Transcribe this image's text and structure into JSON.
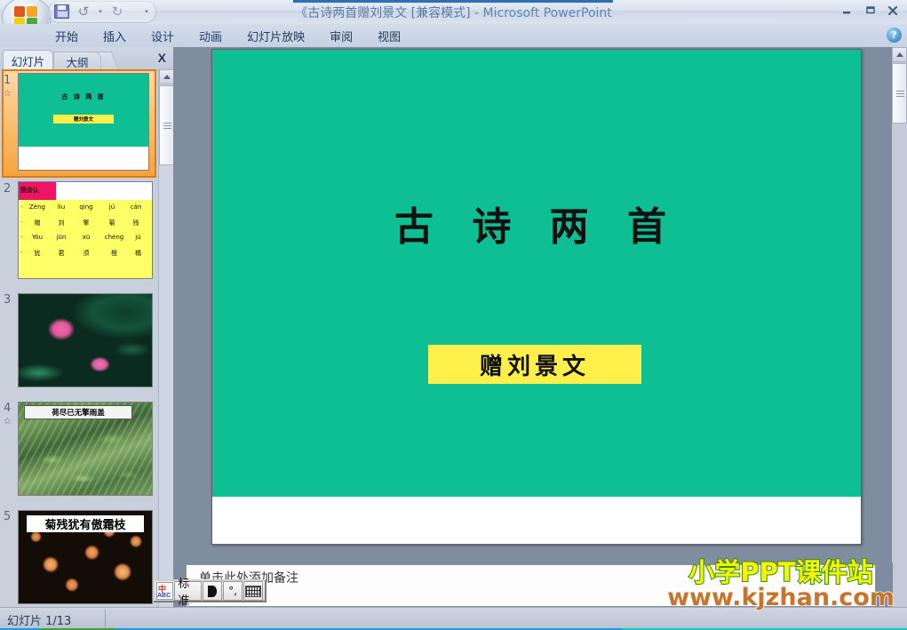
{
  "window": {
    "title": "《古诗两首赠刘景文 [兼容模式]  -  Microsoft PowerPoint",
    "title_doc": "《古诗两首赠刘景文 [兼容模式]",
    "title_sep": " - ",
    "title_app": "Microsoft PowerPoint",
    "minimize": "—",
    "restore": "❐",
    "close": "✕"
  },
  "quick_access": {
    "office_button": "office-orb",
    "save": "save-icon",
    "undo": "undo-icon",
    "undo_more": "▾",
    "redo": "redo-icon",
    "customize": "▾"
  },
  "ribbon": {
    "tabs": [
      {
        "label": "开始"
      },
      {
        "label": "插入"
      },
      {
        "label": "设计"
      },
      {
        "label": "动画"
      },
      {
        "label": "幻灯片放映"
      },
      {
        "label": "审阅"
      },
      {
        "label": "视图"
      }
    ],
    "help": "?"
  },
  "left_panel": {
    "tab_slides": "幻灯片",
    "tab_outline": "大纲",
    "close": "X",
    "slides": [
      {
        "number": "1",
        "has_animation": true,
        "type": "title",
        "title": "古 诗 两 首",
        "subtitle": "赠刘景文",
        "selected": true
      },
      {
        "number": "2",
        "has_animation": false,
        "type": "pinyin",
        "header_label": "我会认",
        "rows": [
          [
            "Zèng",
            "liu",
            "qing",
            "jú",
            "cán"
          ],
          [
            "赠",
            "刘",
            "擎",
            "菊",
            "残"
          ],
          [
            "Yóu",
            "jūn",
            "xū",
            "chéng",
            "jú"
          ],
          [
            "犹",
            "君",
            "须",
            "橙",
            "橘"
          ]
        ]
      },
      {
        "number": "3",
        "has_animation": false,
        "type": "photo-lotus",
        "caption": ""
      },
      {
        "number": "4",
        "has_animation": true,
        "type": "photo-pond",
        "caption": "荷尽已无擎雨盖"
      },
      {
        "number": "5",
        "has_animation": false,
        "type": "photo-mums",
        "caption": "菊残犹有傲霜枝"
      }
    ]
  },
  "slide_editor": {
    "title": "古 诗 两 首",
    "subtitle": "赠刘景文",
    "background_color": "#0fbf94",
    "subtitle_bg": "#ffef4a"
  },
  "notes": {
    "placeholder": "单击此处添加备注"
  },
  "status_bar": {
    "slide_counter": "幻灯片 1/13"
  },
  "ime_bar": {
    "mode_icon": "chinese-english-toggle-icon",
    "mode_label": "标准",
    "shape_icon": "half-moon-icon",
    "punctuation_icon": "punctuation-icon",
    "punctuation_label": "°,",
    "keyboard_icon": "soft-keyboard-icon"
  },
  "scrollbars": {
    "up_arrow": "▲",
    "down_arrow": "▼",
    "prev_slide": "▲▲",
    "next_slide": "▼▼"
  },
  "watermark": {
    "line1": "小学PPT课件站",
    "line2": "www.kjzhan.com",
    "color1": "#f5f500",
    "color1_outline": "#3a8d15",
    "color2": "#c8742a"
  }
}
